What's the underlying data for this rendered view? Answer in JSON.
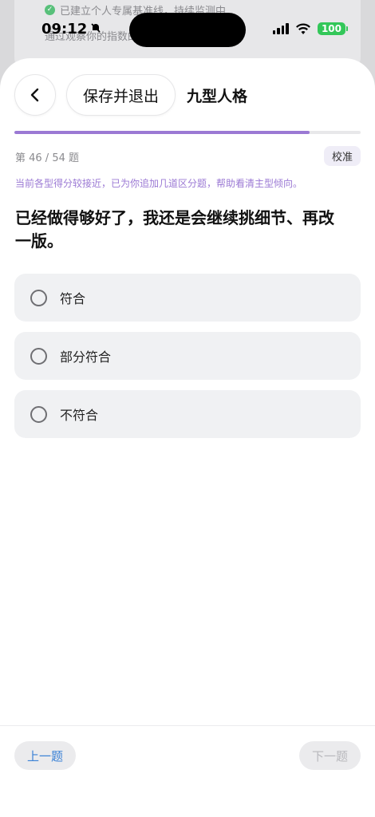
{
  "background": {
    "line1": "已建立个人专属基准线，持续监测中",
    "line2": "通过观察你的指数的"
  },
  "status_bar": {
    "time": "09:12",
    "battery": "100",
    "mute_icon": "bell-slash-icon",
    "signal_icon": "cellular-signal-icon",
    "wifi_icon": "wifi-icon"
  },
  "header": {
    "back_icon": "chevron-left-icon",
    "save_label": "保存并退出",
    "title": "九型人格"
  },
  "progress": {
    "current": 46,
    "total": 54,
    "fraction": 0.8519,
    "counter_text": "第 46 / 54 题",
    "calibrate_label": "校准"
  },
  "hint": "当前各型得分较接近，已为你追加几道区分题，帮助看清主型倾向。",
  "question": "已经做得够好了，我还是会继续挑细节、再改一版。",
  "options": [
    {
      "label": "符合"
    },
    {
      "label": "部分符合"
    },
    {
      "label": "不符合"
    }
  ],
  "footer": {
    "prev_label": "上一题",
    "next_label": "下一题"
  },
  "colors": {
    "accent": "#9b79d4",
    "link": "#3b82d6",
    "battery": "#33c759"
  }
}
